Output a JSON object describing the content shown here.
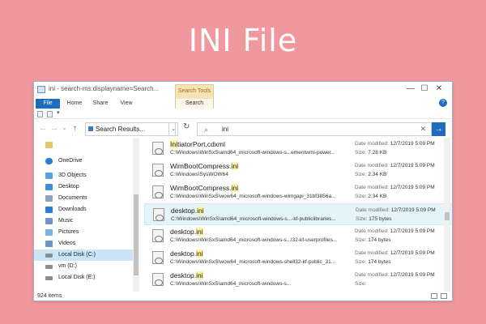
{
  "headline": "INI File",
  "window": {
    "title": "ini - search-ms:displayname=Search...",
    "context_tab": "Search Tools",
    "controls": {
      "minimize": "—",
      "maximize": "☐",
      "close": "✕"
    }
  },
  "ribbon": {
    "tabs": [
      "File",
      "Home",
      "Share",
      "View",
      "Search"
    ],
    "help": "?"
  },
  "address": {
    "back": "←",
    "forward": "→",
    "recent": "⌄",
    "up": "↑",
    "path": "Search Results...",
    "dropdown": "⌄",
    "refresh": "↻"
  },
  "search": {
    "value": "ini",
    "search_icon": "⌕",
    "clear": "✕",
    "go": "→"
  },
  "nav_pane": {
    "items": [
      {
        "label": "",
        "icon": "folder-icon",
        "color": "#e8c36a"
      },
      {
        "label": "OneDrive",
        "icon": "cloud-icon",
        "color": "#2b7cd3"
      },
      {
        "label": "3D Objects",
        "icon": "cube-icon",
        "color": "#5aa0e6"
      },
      {
        "label": "Desktop",
        "icon": "desktop-icon",
        "color": "#3d8fdc"
      },
      {
        "label": "Documents",
        "icon": "documents-icon",
        "color": "#8aa4c3"
      },
      {
        "label": "Downloads",
        "icon": "download-icon",
        "color": "#2b7cd3"
      },
      {
        "label": "Music",
        "icon": "music-icon",
        "color": "#6f94c9"
      },
      {
        "label": "Pictures",
        "icon": "pictures-icon",
        "color": "#7ab2e8"
      },
      {
        "label": "Videos",
        "icon": "videos-icon",
        "color": "#6f94c9"
      },
      {
        "label": "Local Disk (C:)",
        "icon": "drive-icon",
        "color": "#8c8c8c"
      },
      {
        "label": "vm (D:)",
        "icon": "drive-icon",
        "color": "#8c8c8c"
      },
      {
        "label": "Local Disk (E:)",
        "icon": "drive-icon",
        "color": "#8c8c8c"
      }
    ]
  },
  "results": {
    "date_label": "Date modified:",
    "size_label": "Size:",
    "rows": [
      {
        "name_hl": "Ini",
        "name_rest": "tiatorPort.cdxml",
        "path": "C:\\Windows\\WinSxS\\amd64_microsoft-windows-s...ementwmi-power...",
        "date": "12/7/2019 5:09 PM",
        "size": "7.28 KB"
      },
      {
        "name_pre": "WimBootCompress.",
        "name_hl": "ini",
        "path": "C:\\Windows\\SysWOW64",
        "date": "12/7/2019 5:09 PM",
        "size": "2.34 KB"
      },
      {
        "name_pre": "WimBootCompress.",
        "name_hl": "ini",
        "path": "C:\\Windows\\WinSxS\\wow64_microsoft-windows-wimgapi_31bf3856a...",
        "date": "12/7/2019 5:09 PM",
        "size": "2.34 KB"
      },
      {
        "name_pre": "desktop.",
        "name_hl": "ini",
        "path": "C:\\Windows\\WinSxS\\amd64_microsoft-windows-s...-kf-publiclibraries...",
        "date": "12/7/2019 5:09 PM",
        "size": "175 bytes"
      },
      {
        "name_pre": "desktop.",
        "name_hl": "ini",
        "path": "C:\\Windows\\WinSxS\\amd64_microsoft-windows-s...l32-kf-userprofiles...",
        "date": "12/7/2019 5:09 PM",
        "size": "174 bytes"
      },
      {
        "name_pre": "desktop.",
        "name_hl": "ini",
        "path": "C:\\Windows\\WinSxS\\wow64_microsoft-windows-shell32-kf-public_31...",
        "date": "12/7/2019 5:09 PM",
        "size": "174 bytes"
      },
      {
        "name_pre": "desktop.",
        "name_hl": "ini",
        "path": "C:\\Windows\\WinSxS\\amd64_microsoft-windows-s...",
        "date": "12/7/2019 5:09 PM",
        "size": ""
      }
    ]
  },
  "status": {
    "count": "924 items"
  },
  "colors": {
    "background": "#f0989d",
    "accent": "#1f6cbd",
    "highlight": "#fef4a0"
  }
}
